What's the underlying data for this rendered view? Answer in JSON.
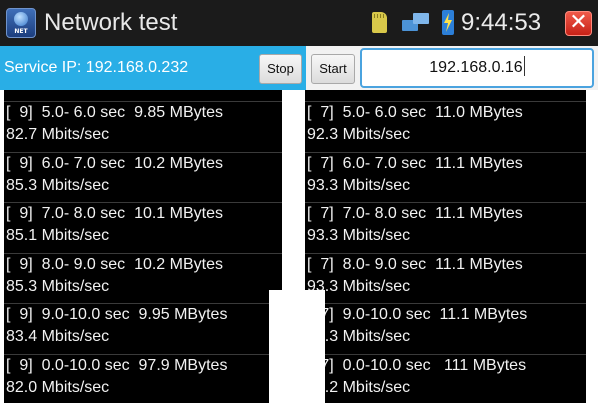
{
  "titlebar": {
    "app_icon": "network-test-app-icon",
    "app_icon_tag": "NET",
    "title": "Network test",
    "status_icons": [
      "sd-card-icon",
      "network-icon",
      "battery-charging-icon"
    ],
    "time": "9:44:53",
    "close_icon": "close-x-icon"
  },
  "toolbar": {
    "service_ip": "Service IP: 192.168.0.232",
    "stop_label": "Stop",
    "start_label": "Start",
    "target_ip": "192.168.0.16",
    "accent_color": "#29aee6"
  },
  "left_results": [
    {
      "line1": "[  9]  5.0- 6.0 sec  9.85 MBytes",
      "line2": "82.7 Mbits/sec"
    },
    {
      "line1": "[  9]  6.0- 7.0 sec  10.2 MBytes",
      "line2": "85.3 Mbits/sec"
    },
    {
      "line1": "[  9]  7.0- 8.0 sec  10.1 MBytes",
      "line2": "85.1 Mbits/sec"
    },
    {
      "line1": "[  9]  8.0- 9.0 sec  10.2 MBytes",
      "line2": "85.3 Mbits/sec"
    },
    {
      "line1": "[  9]  9.0-10.0 sec  9.95 MBytes",
      "line2": "83.4 Mbits/sec"
    },
    {
      "line1": "[  9]  0.0-10.0 sec  97.9 MBytes",
      "line2": "82.0 Mbits/sec"
    }
  ],
  "right_results": [
    {
      "line1": "[  7]  5.0- 6.0 sec  11.0 MBytes",
      "line2": "92.3 Mbits/sec"
    },
    {
      "line1": "[  7]  6.0- 7.0 sec  11.1 MBytes",
      "line2": "93.3 Mbits/sec"
    },
    {
      "line1": "[  7]  7.0- 8.0 sec  11.1 MBytes",
      "line2": "93.3 Mbits/sec"
    },
    {
      "line1": "[  7]  8.0- 9.0 sec  11.1 MBytes",
      "line2": "93.3 Mbits/sec"
    },
    {
      "line1": "[  7]  9.0-10.0 sec  11.1 MBytes",
      "line2": "93.3 Mbits/sec"
    },
    {
      "line1": "[  7]  0.0-10.0 sec   111 MBytes",
      "line2": "93.2 Mbits/sec"
    }
  ]
}
